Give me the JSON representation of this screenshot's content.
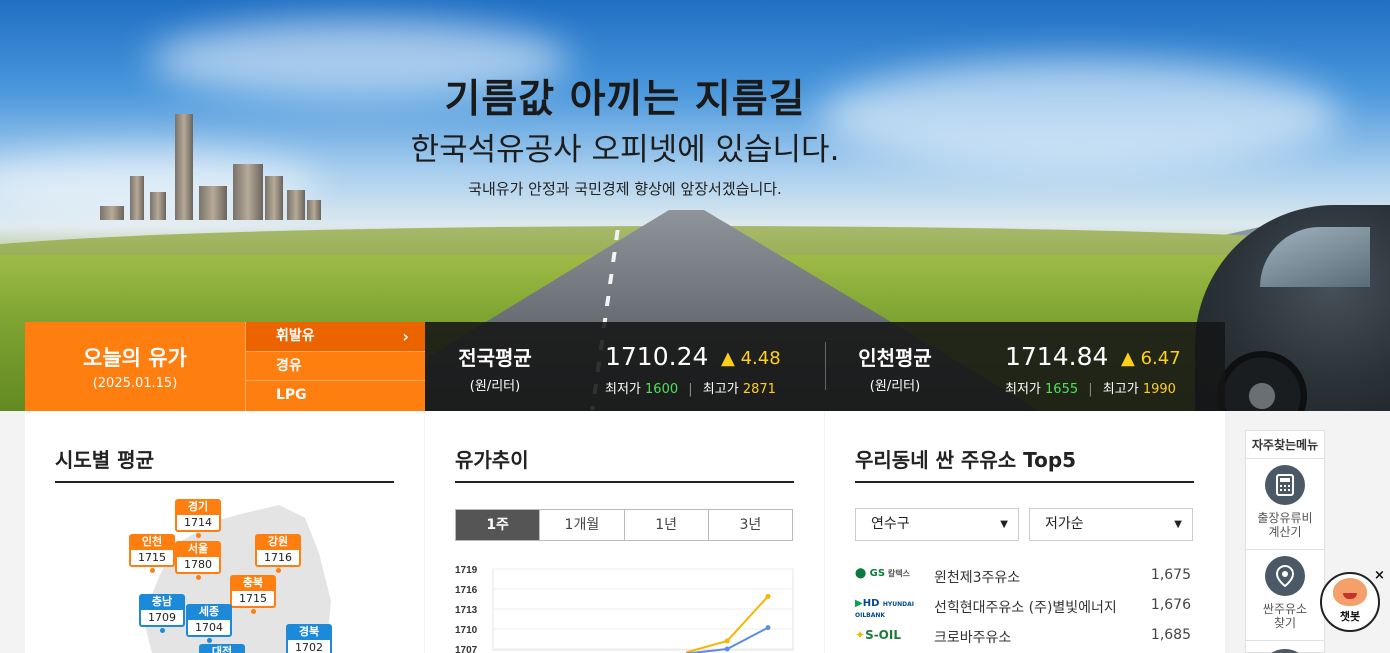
{
  "hero": {
    "title": "기름값 아끼는 지름길",
    "subtitle": "한국석유공사 오피넷에 있습니다.",
    "description": "국내유가 안정과 국민경제 향상에 앞장서겠습니다."
  },
  "today": {
    "title": "오늘의 유가",
    "date": "(2025.01.15)"
  },
  "fuel_tabs": [
    {
      "label": "휘발유",
      "active": true
    },
    {
      "label": "경유",
      "active": false
    },
    {
      "label": "LPG",
      "active": false
    }
  ],
  "national": {
    "label": "전국평균",
    "unit": "(원/리터)",
    "price": "1710.24",
    "change": "▲ 4.48",
    "low_label": "최저가",
    "low": "1600",
    "high_label": "최고가",
    "high": "2871",
    "separator": "|"
  },
  "incheon": {
    "label": "인천평균",
    "unit": "(원/리터)",
    "price": "1714.84",
    "change": "▲ 6.47",
    "low_label": "최저가",
    "low": "1655",
    "high_label": "최고가",
    "high": "1990",
    "separator": "|"
  },
  "regional": {
    "title": "시도별 평균",
    "pins": [
      {
        "name": "경기",
        "value": "1714",
        "color": "o"
      },
      {
        "name": "인천",
        "value": "1715",
        "color": "o"
      },
      {
        "name": "서울",
        "value": "1780",
        "color": "o"
      },
      {
        "name": "강원",
        "value": "1716",
        "color": "o"
      },
      {
        "name": "충북",
        "value": "1715",
        "color": "o"
      },
      {
        "name": "충남",
        "value": "1709",
        "color": "b"
      },
      {
        "name": "세종",
        "value": "1704",
        "color": "b"
      },
      {
        "name": "경북",
        "value": "1702",
        "color": "b"
      },
      {
        "name": "대전",
        "value": "",
        "color": "b"
      }
    ]
  },
  "trend": {
    "title": "유가추이",
    "tabs": [
      "1주",
      "1개월",
      "1년",
      "3년"
    ],
    "active_tab": "1주"
  },
  "chart_data": {
    "type": "line",
    "yticks": [
      "1719",
      "1716",
      "1713",
      "1710",
      "1707"
    ],
    "ylim": [
      1707,
      1719
    ],
    "series": [
      {
        "name": "",
        "color": "#f7b500",
        "values": [
          null,
          null,
          null,
          null,
          1706.5,
          1708.2,
          1714.9
        ]
      },
      {
        "name": "",
        "color": "#5a8fe0",
        "values": [
          null,
          null,
          null,
          null,
          1706.3,
          1707.0,
          1710.2
        ]
      }
    ]
  },
  "top5": {
    "title": "우리동네 싼 주유소 Top5",
    "district": "연수구",
    "sort": "저가순",
    "stations": [
      {
        "brand": "GS칼텍스",
        "name": "윈천제3주유소",
        "price": "1,675",
        "brand_color": "#0a7b3e"
      },
      {
        "brand": "HD HYUNDAI OILBANK",
        "name": "선힉현대주유소 (주)별빛에너지",
        "price": "1,676",
        "brand_color": "#004a8f"
      },
      {
        "brand": "S-OIL",
        "name": "크로바주유소",
        "price": "1,685",
        "brand_color": "#f6b800"
      }
    ]
  },
  "quick_menu": {
    "title": "자주찾는메뉴",
    "items": [
      {
        "label_1": "출장유류비",
        "label_2": "계산기",
        "icon": "calculator-icon"
      },
      {
        "label_1": "싼주유소",
        "label_2": "찾기",
        "icon": "location-pin-icon"
      }
    ]
  },
  "chatbot": {
    "label": "챗봇",
    "close": "×"
  }
}
